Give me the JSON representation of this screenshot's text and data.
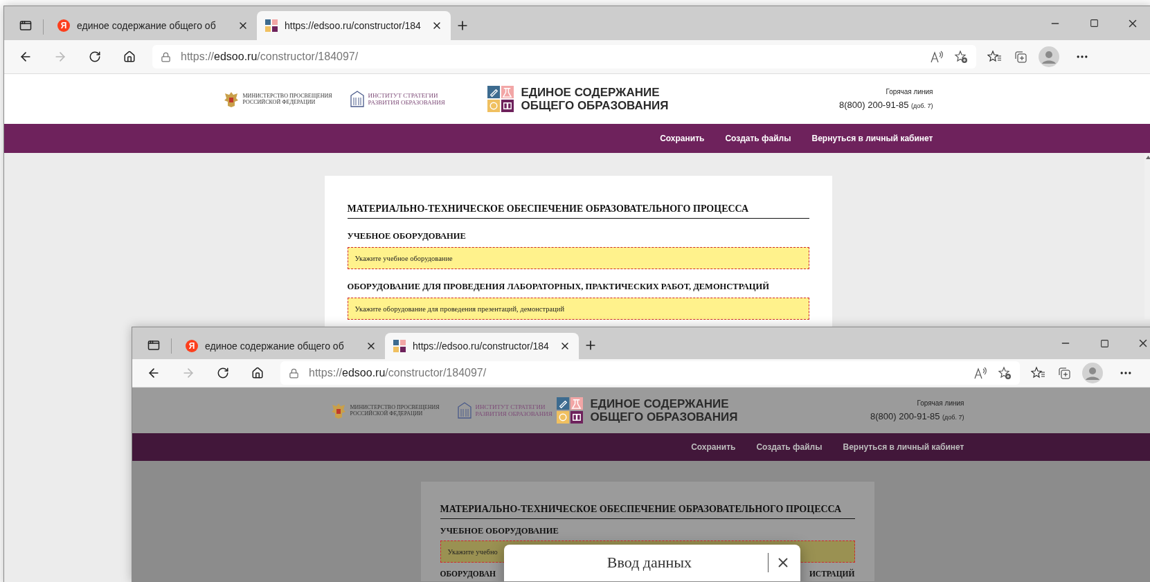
{
  "windows": [
    {
      "tabs": [
        {
          "title": "единое содержание общего об",
          "favicon": {
            "kind": "letter",
            "text": "Я"
          },
          "selected": false
        },
        {
          "title": "https://edsoo.ru/constructor/184",
          "favicon": {
            "kind": "tiles"
          },
          "selected": true
        }
      ],
      "address": {
        "scheme": "https://",
        "host": "edsoo.ru",
        "path": "/constructor/184097/"
      },
      "forward_disabled": true,
      "dimmed": false,
      "site": {
        "ministry": "МИНИСТЕРСТВО ПРОСВЕЩЕНИЯ\nРОССИЙСКОЙ ФЕДЕРАЦИИ",
        "institute": "ИНСТИТУТ СТРАТЕГИИ\nРАЗВИТИЯ ОБРАЗОВАНИЯ",
        "logo_title": "ЕДИНОЕ СОДЕРЖАНИЕ\nОБЩЕГО ОБРАЗОВАНИЯ",
        "hotline_label": "Горячая линия",
        "hotline_number": "8(800) 200-91-85",
        "hotline_ext": "(доб. 7)"
      },
      "menu": [
        "Сохранить",
        "Создать файлы",
        "Вернуться в личный кабинет"
      ],
      "document": {
        "title": "МАТЕРИАЛЬНО-ТЕХНИЧЕСКОЕ ОБЕСПЕЧЕНИЕ ОБРАЗОВАТЕЛЬНОГО ПРОЦЕССА",
        "sections": [
          {
            "heading": "УЧЕБНОЕ ОБОРУДОВАНИЕ",
            "prompt": "Укажите учебное оборудование"
          },
          {
            "heading": "ОБОРУДОВАНИЕ ДЛЯ ПРОВЕДЕНИЯ ЛАБОРАТОРНЫХ, ПРАКТИЧЕСКИХ РАБОТ, ДЕМОНСТРАЦИЙ",
            "prompt": "Укажите оборудование для проведения презентаций, демонстраций"
          }
        ]
      }
    },
    {
      "tabs": [
        {
          "title": "единое содержание общего об",
          "favicon": {
            "kind": "letter",
            "text": "Я"
          },
          "selected": false
        },
        {
          "title": "https://edsoo.ru/constructor/184",
          "favicon": {
            "kind": "tiles"
          },
          "selected": true
        }
      ],
      "address": {
        "scheme": "https://",
        "host": "edsoo.ru",
        "path": "/constructor/184097/"
      },
      "forward_disabled": true,
      "dimmed": true,
      "site": {
        "ministry": "МИНИСТЕРСТВО ПРОСВЕЩЕНИЯ\nРОССИЙСКОЙ ФЕДЕРАЦИИ",
        "institute": "ИНСТИТУТ СТРАТЕГИИ\nРАЗВИТИЯ ОБРАЗОВАНИЯ",
        "logo_title": "ЕДИНОЕ СОДЕРЖАНИЕ\nОБЩЕГО ОБРАЗОВАНИЯ",
        "hotline_label": "Горячая линия",
        "hotline_number": "8(800) 200-91-85",
        "hotline_ext": "(доб. 7)"
      },
      "menu": [
        "Сохранить",
        "Создать файлы",
        "Вернуться в личный кабинет"
      ],
      "document": {
        "title": "МАТЕРИАЛЬНО-ТЕХНИЧЕСКОЕ ОБЕСПЕЧЕНИЕ ОБРАЗОВАТЕЛЬНОГО ПРОЦЕССА",
        "sections": [
          {
            "heading": "УЧЕБНОЕ ОБОРУДОВАНИЕ",
            "prompt": "Укажите учебно"
          },
          {
            "heading_parts": [
              "ОБОРУДОВАН",
              "ИСТРАЦИЙ"
            ]
          }
        ]
      },
      "dialog": {
        "title": "Ввод данных"
      }
    }
  ]
}
